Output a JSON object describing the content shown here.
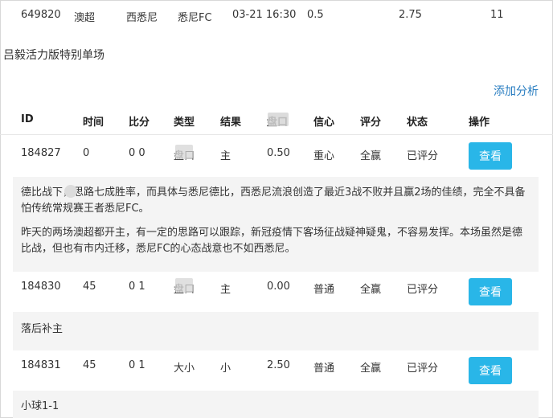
{
  "top_row": {
    "id": "649820",
    "league": "澳超",
    "home": "西悉尼",
    "away": "悉尼FC",
    "time": "03-21 16:30",
    "handicap": "0.5",
    "odds": "2.75",
    "count": "11"
  },
  "section_title": "吕毅活力版特别单场",
  "add_analysis": "添加分析",
  "table": {
    "headers": [
      "ID",
      "时间",
      "比分",
      "类型",
      "结果",
      "盘口",
      "信心",
      "评分",
      "状态",
      "操作"
    ],
    "rows": [
      {
        "id": "184827",
        "time": "0",
        "score": "0 0",
        "type": "盘口",
        "result": "主",
        "line": "0.50",
        "confidence": "重心",
        "rating": "全赢",
        "status": "已评分",
        "action": "查看",
        "notes": [
          "德比战下，思路七成胜率，而具体与悉尼德比，西悉尼流浪创造了最近3战不败并且赢2场的佳绩，完全不具备怕传统常规赛王者悉尼FC。",
          "昨天的两场澳超都开主，有一定的思路可以跟踪，新冠疫情下客场征战疑神疑鬼，不容易发挥。本场虽然是德比战，但也有市内迁移，悉尼FC的心态战意也不如西悉尼。"
        ]
      },
      {
        "id": "184830",
        "time": "45",
        "score": "0 1",
        "type": "盘口",
        "result": "主",
        "line": "0.00",
        "confidence": "普通",
        "rating": "全赢",
        "status": "已评分",
        "action": "查看",
        "notes": [
          "落后补主"
        ]
      },
      {
        "id": "184831",
        "time": "45",
        "score": "0 1",
        "type": "大小",
        "result": "小",
        "line": "2.50",
        "confidence": "普通",
        "rating": "全赢",
        "status": "已评分",
        "action": "查看",
        "notes": [
          "小球1-1"
        ]
      }
    ]
  }
}
